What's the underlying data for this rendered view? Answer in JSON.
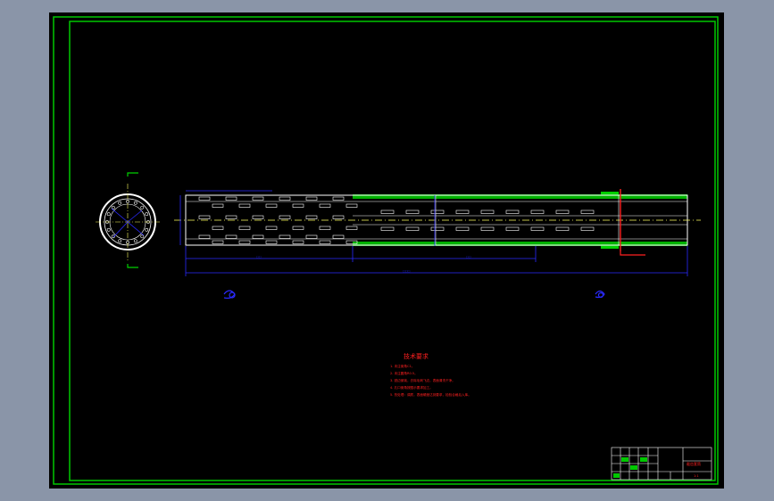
{
  "colors": {
    "background": "#000000",
    "frame": "#00c800",
    "outline": "#ffffff",
    "dimension": "#2a2aff",
    "notes": "#ff2020",
    "hatch": "#00d000",
    "centerline": "#ffff60",
    "titleblock": "#ffffff"
  },
  "notes": {
    "heading": "技术要求",
    "lines": [
      "1. 未注倒角C1。",
      "2. 未注圆角R0.5。",
      "3. 锐边倒钝，去除毛刺飞边，表面清洗干净。",
      "4. 孔口倒角按图示要求加工。",
      "5. 热处理：调质，表面硬度达到要求，检验合格后入库。"
    ]
  },
  "view_labels": {
    "section_a": "A-A",
    "section_b": "B-B",
    "detail_i": "I"
  },
  "titleblock": {
    "part_name": "截齿套筒",
    "scale": "1:1"
  }
}
